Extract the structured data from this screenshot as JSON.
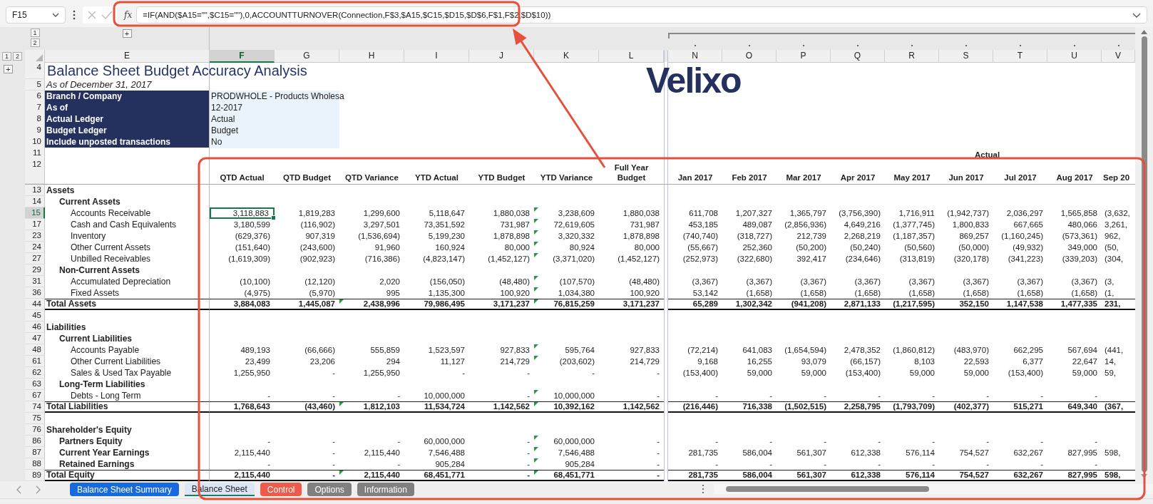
{
  "formula_bar": {
    "name_box": "F15",
    "function_label": "fx",
    "formula": "=IF(AND($A15=\"\",$C15=\"\"),0,ACCOUNTTURNOVER(Connection,F$3,$A15,$C15,$D15,$D$6,F$1,F$2,$D$10))"
  },
  "outline": {
    "column_levels": [
      "1",
      "2"
    ],
    "row_levels": [
      "1",
      "2"
    ],
    "column_expand": "+",
    "row_expand": "+"
  },
  "logo": "Velixo",
  "sheet": {
    "columns": [
      {
        "kind": "label",
        "letter": "E",
        "selected": false
      },
      {
        "kind": "value",
        "letter": "F",
        "selected": true
      },
      {
        "kind": "value",
        "letter": "G",
        "selected": false
      },
      {
        "kind": "value",
        "letter": "H",
        "selected": false
      },
      {
        "kind": "value",
        "letter": "I",
        "selected": false
      },
      {
        "kind": "value",
        "letter": "J",
        "selected": false
      },
      {
        "kind": "value",
        "letter": "K",
        "selected": false
      },
      {
        "kind": "value",
        "letter": "L",
        "selected": false
      },
      {
        "kind": "gap"
      },
      {
        "kind": "value",
        "letter": "N",
        "selected": false
      },
      {
        "kind": "value",
        "letter": "O",
        "selected": false
      },
      {
        "kind": "value",
        "letter": "P",
        "selected": false
      },
      {
        "kind": "value",
        "letter": "Q",
        "selected": false
      },
      {
        "kind": "value",
        "letter": "R",
        "selected": false
      },
      {
        "kind": "value",
        "letter": "S",
        "selected": false
      },
      {
        "kind": "value",
        "letter": "T",
        "selected": false
      },
      {
        "kind": "value",
        "letter": "U",
        "selected": false
      },
      {
        "kind": "value",
        "letter": "V",
        "selected": false
      }
    ],
    "rows": [
      {
        "number": "4",
        "kind": "title",
        "selected": false,
        "label": "Balance Sheet Budget Accuracy Analysis"
      },
      {
        "number": "5",
        "kind": "subtitle",
        "selected": false,
        "label": "As of December 31, 2017"
      },
      {
        "number": "6",
        "kind": "parameter",
        "selected": false,
        "label": "Branch / Company",
        "value": "PRODWHOLE - Products Wholesa"
      },
      {
        "number": "7",
        "kind": "parameter",
        "selected": false,
        "label": "As of",
        "value": "12-2017"
      },
      {
        "number": "8",
        "kind": "parameter",
        "selected": false,
        "label": "Actual Ledger",
        "value": "Actual"
      },
      {
        "number": "9",
        "kind": "parameter",
        "selected": false,
        "label": "Budget Ledger",
        "value": "Budget"
      },
      {
        "number": "10",
        "kind": "parameter",
        "selected": false,
        "label": "Include unposted transactions",
        "value": "No"
      },
      {
        "number": "11",
        "kind": "band",
        "selected": false,
        "band_label": "Actual"
      },
      {
        "number": "12",
        "kind": "column_header",
        "selected": false,
        "cells": [
          "QTD Actual",
          "QTD Budget",
          "QTD Variance",
          "YTD Actual",
          "YTD Budget",
          "YTD Variance",
          "Full Year Budget",
          "Jan 2017",
          "Feb 2017",
          "Mar 2017",
          "Apr 2017",
          "May 2017",
          "Jun 2017",
          "Jul 2017",
          "Aug 2017",
          "Sep 20"
        ]
      },
      {
        "number": "13",
        "kind": "section",
        "selected": false,
        "label": "Assets"
      },
      {
        "number": "14",
        "kind": "group",
        "selected": false,
        "label": "Current Assets"
      },
      {
        "number": "15",
        "kind": "account",
        "selected": true,
        "label": "Accounts Receivable",
        "flags": {
          "qtd_variance": false,
          "ytd_variance": true
        },
        "cells": [
          "3,118,883",
          "1,819,283",
          "1,299,600",
          "5,118,647",
          "1,880,038",
          "3,238,609",
          "1,880,038",
          "611,708",
          "1,207,327",
          "1,365,797",
          "(3,756,390)",
          "1,716,911",
          "(1,942,737)",
          "2,036,297",
          "1,565,858",
          "(3,632,"
        ]
      },
      {
        "number": "17",
        "kind": "account",
        "selected": false,
        "label": "Cash and Cash Equivalents",
        "flags": {
          "qtd_variance": false,
          "ytd_variance": true
        },
        "cells": [
          "3,180,599",
          "(116,902)",
          "3,297,501",
          "73,351,592",
          "731,987",
          "72,619,605",
          "731,987",
          "453,185",
          "489,087",
          "(2,856,936)",
          "4,649,216",
          "(1,377,745)",
          "1,800,833",
          "667,665",
          "480,066",
          "3,261,"
        ]
      },
      {
        "number": "23",
        "kind": "account",
        "selected": false,
        "label": "Inventory",
        "flags": {
          "qtd_variance": false,
          "ytd_variance": true
        },
        "cells": [
          "(629,376)",
          "907,319",
          "(1,536,694)",
          "5,199,230",
          "1,878,898",
          "3,320,332",
          "1,878,898",
          "(740,740)",
          "(318,727)",
          "212,739",
          "2,268,219",
          "(1,187,357)",
          "869,257",
          "(1,160,245)",
          "(573,361)",
          "962,"
        ]
      },
      {
        "number": "24",
        "kind": "account",
        "selected": false,
        "label": "Other Current Assets",
        "flags": {
          "qtd_variance": false,
          "ytd_variance": true
        },
        "cells": [
          "(151,640)",
          "(243,600)",
          "91,960",
          "160,924",
          "80,000",
          "80,924",
          "80,000",
          "(55,667)",
          "252,360",
          "(50,200)",
          "(50,240)",
          "(50,560)",
          "(50,000)",
          "(49,932)",
          "349,000",
          "(50,"
        ]
      },
      {
        "number": "27",
        "kind": "account",
        "selected": false,
        "label": "Unbilled Receivables",
        "flags": {
          "qtd_variance": false,
          "ytd_variance": true
        },
        "cells": [
          "(1,619,309)",
          "(902,923)",
          "(716,386)",
          "(4,823,147)",
          "(1,452,127)",
          "(3,371,020)",
          "(1,452,127)",
          "(252,973)",
          "(322,680)",
          "392,417",
          "(234,646)",
          "(313,819)",
          "(320,178)",
          "(341,223)",
          "(339,203)",
          "(304,"
        ]
      },
      {
        "number": "29",
        "kind": "group",
        "selected": false,
        "label": "Non-Current Assets"
      },
      {
        "number": "31",
        "kind": "account",
        "selected": false,
        "label": "Accumulated Depreciation",
        "flags": {
          "qtd_variance": false,
          "ytd_variance": true
        },
        "cells": [
          "(10,100)",
          "(12,120)",
          "2,020",
          "(156,050)",
          "(48,480)",
          "(107,570)",
          "(48,480)",
          "(3,367)",
          "(3,367)",
          "(3,367)",
          "(3,367)",
          "(3,367)",
          "(3,367)",
          "(3,367)",
          "(3,367)",
          "(3,"
        ]
      },
      {
        "number": "36",
        "kind": "account",
        "selected": false,
        "label": "Fixed Assets",
        "flags": {
          "qtd_variance": false,
          "ytd_variance": true
        },
        "cells": [
          "(4,975)",
          "(5,970)",
          "995",
          "1,135,300",
          "100,920",
          "1,034,380",
          "100,920",
          "53,142",
          "(1,658)",
          "(1,658)",
          "(1,658)",
          "(1,658)",
          "(1,658)",
          "(1,658)",
          "(1,658)",
          "(1,"
        ]
      },
      {
        "number": "44",
        "kind": "total",
        "selected": false,
        "label": "Total Assets",
        "flags": {
          "qtd_variance": true,
          "ytd_variance": true
        },
        "cells": [
          "3,884,083",
          "1,445,087",
          "2,438,996",
          "79,986,495",
          "3,171,237",
          "76,815,259",
          "3,171,237",
          "65,289",
          "1,302,342",
          "(941,208)",
          "2,871,133",
          "(1,217,595)",
          "352,150",
          "1,147,538",
          "1,477,335",
          "231,"
        ]
      },
      {
        "number": "45",
        "kind": "blank",
        "selected": false
      },
      {
        "number": "46",
        "kind": "section",
        "selected": false,
        "label": "Liabilities"
      },
      {
        "number": "47",
        "kind": "group",
        "selected": false,
        "label": "Current Liabilities"
      },
      {
        "number": "48",
        "kind": "account",
        "selected": false,
        "label": "Accounts Payable",
        "flags": {
          "qtd_variance": false,
          "ytd_variance": true
        },
        "cells": [
          "489,193",
          "(66,666)",
          "555,859",
          "1,523,597",
          "927,833",
          "595,764",
          "927,833",
          "(72,214)",
          "641,083",
          "(1,654,594)",
          "2,478,352",
          "(1,860,812)",
          "(483,970)",
          "662,295",
          "567,694",
          "(441,"
        ]
      },
      {
        "number": "61",
        "kind": "account",
        "selected": false,
        "label": "Other Current Liabilities",
        "flags": {
          "qtd_variance": false,
          "ytd_variance": true
        },
        "cells": [
          "23,499",
          "23,206",
          "294",
          "11,127",
          "214,729",
          "(203,602)",
          "214,729",
          "9,168",
          "16,255",
          "93,079",
          "(66,157)",
          "8,103",
          "22,593",
          "6,377",
          "22,647",
          "14,"
        ]
      },
      {
        "number": "62",
        "kind": "account",
        "selected": false,
        "label": "Sales & Used Tax Payable",
        "flags": {
          "qtd_variance": false,
          "ytd_variance": false
        },
        "cells": [
          "1,255,950",
          "-",
          "1,255,950",
          "-",
          "-",
          "-",
          "-",
          "(153,400)",
          "59,000",
          "59,000",
          "(153,400)",
          "59,000",
          "59,000",
          "(153,400)",
          "59,000",
          "59,"
        ]
      },
      {
        "number": "63",
        "kind": "group",
        "selected": false,
        "label": "Long-Term Liabilities"
      },
      {
        "number": "67",
        "kind": "account",
        "selected": false,
        "label": "Debts - Long Term",
        "flags": {
          "qtd_variance": false,
          "ytd_variance": true
        },
        "cells": [
          "-",
          "-",
          "-",
          "10,000,000",
          "-",
          "10,000,000",
          "-",
          "-",
          "-",
          "-",
          "-",
          "-",
          "-",
          "-",
          "-"
        ]
      },
      {
        "number": "74",
        "kind": "total",
        "selected": false,
        "label": "Total Liabilities",
        "flags": {
          "qtd_variance": true,
          "ytd_variance": true
        },
        "cells": [
          "1,768,643",
          "(43,460)",
          "1,812,103",
          "11,534,724",
          "1,142,562",
          "10,392,162",
          "1,142,562",
          "(216,446)",
          "716,338",
          "(1,502,515)",
          "2,258,795",
          "(1,793,709)",
          "(402,377)",
          "515,271",
          "649,340",
          "(367,"
        ]
      },
      {
        "number": "75",
        "kind": "blank",
        "selected": false
      },
      {
        "number": "76",
        "kind": "section",
        "selected": false,
        "label": "Shareholder's Equity"
      },
      {
        "number": "86",
        "kind": "group",
        "selected": false,
        "label": "Partners Equity",
        "flags": {
          "qtd_variance": false,
          "ytd_variance": true
        },
        "cells": [
          "-",
          "-",
          "-",
          "60,000,000",
          "-",
          "60,000,000",
          "-",
          "-",
          "-",
          "-",
          "-",
          "-",
          "-",
          "-",
          "-"
        ]
      },
      {
        "number": "87",
        "kind": "group",
        "selected": false,
        "label": "Current Year Earnings",
        "flags": {
          "qtd_variance": false,
          "ytd_variance": true
        },
        "cells": [
          "2,115,440",
          "-",
          "2,115,440",
          "7,546,488",
          "-",
          "7,546,488",
          "-",
          "281,735",
          "586,004",
          "561,307",
          "612,338",
          "576,114",
          "754,527",
          "632,267",
          "827,995",
          "598,"
        ]
      },
      {
        "number": "88",
        "kind": "group",
        "selected": false,
        "label": "Retained Earnings",
        "flags": {
          "qtd_variance": false,
          "ytd_variance": true
        },
        "cells": [
          "-",
          "-",
          "-",
          "905,284",
          "-",
          "905,284",
          "-",
          "-",
          "-",
          "-",
          "-",
          "-",
          "-",
          "-",
          "-"
        ]
      },
      {
        "number": "89",
        "kind": "total",
        "selected": false,
        "label": "Total Equity",
        "flags": {
          "qtd_variance": true,
          "ytd_variance": true
        },
        "cells": [
          "2,115,440",
          "-",
          "2,115,440",
          "68,451,771",
          "-",
          "68,451,771",
          "-",
          "281,735",
          "586,004",
          "561,307",
          "612,338",
          "576,114",
          "754,527",
          "632,267",
          "827,995",
          "598,"
        ]
      }
    ]
  },
  "sheet_tabs": [
    {
      "label": "Balance Sheet Summary",
      "color": "#1769e0",
      "selected": false
    },
    {
      "label": "Balance Sheet",
      "color": "#1e7b6a",
      "selected": true
    },
    {
      "label": "Control",
      "color": "#ef5b4a",
      "selected": false
    },
    {
      "label": "Options",
      "color": "#808080",
      "selected": false
    },
    {
      "label": "Information",
      "color": "#808080",
      "selected": false
    }
  ]
}
